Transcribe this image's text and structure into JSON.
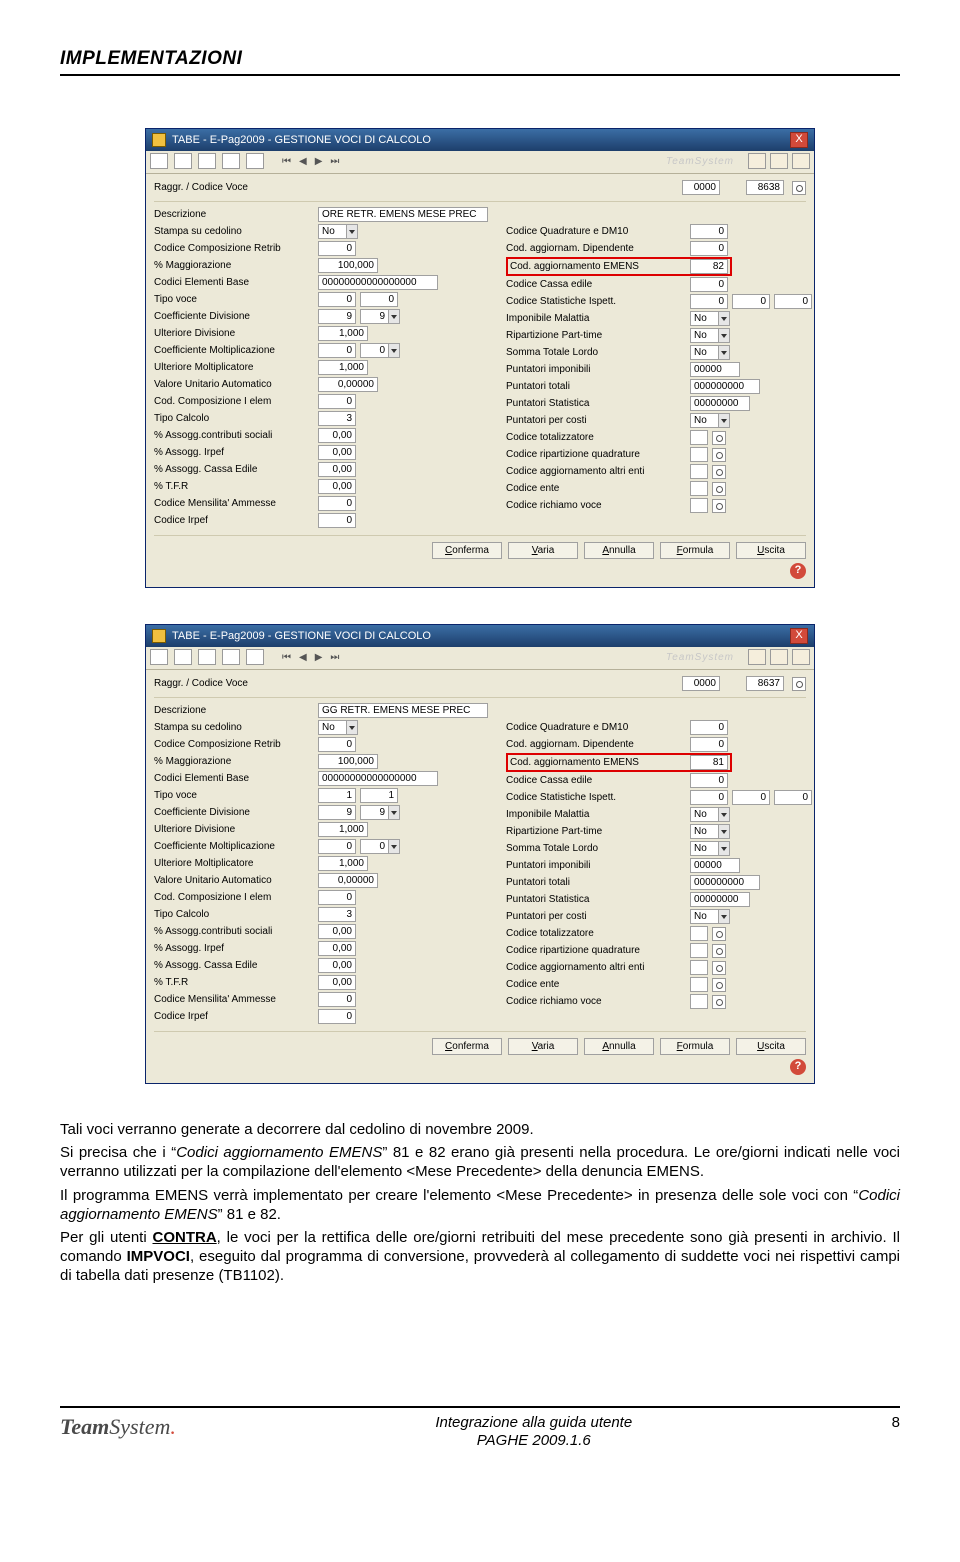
{
  "page_header": "IMPLEMENTAZIONI",
  "window_title": "TABE  -  E-Pag2009  -  GESTIONE VOCI DI CALCOLO",
  "brand": "TeamSystem",
  "close_x": "X",
  "nav": {
    "first": "⏮",
    "prev": "◀",
    "next": "▶",
    "last": "⏭"
  },
  "top": {
    "label": "Raggr. / Codice Voce",
    "v1": "0000",
    "v2_a": "8638",
    "v2_b": "8637"
  },
  "labels_left": [
    "Descrizione",
    "Stampa su cedolino",
    "Codice Composizione Retrib",
    "% Maggiorazione",
    "Codici Elementi Base",
    "Tipo voce",
    "Coefficiente Divisione",
    "Ulteriore Divisione",
    "Coefficiente Moltiplicazione",
    "Ulteriore Moltiplicatore",
    "Valore Unitario Automatico",
    "Cod. Composizione I elem",
    "Tipo Calcolo",
    "% Assogg.contributi sociali",
    "% Assogg. Irpef",
    "% Assogg. Cassa Edile",
    "% T.F.R",
    "Codice Mensilita' Ammesse",
    "Codice Irpef"
  ],
  "labels_right": [
    "Codice Quadrature e DM10",
    "Cod. aggiornam. Dipendente",
    "Cod. aggiornamento EMENS",
    "Codice Cassa edile",
    "Codice Statistiche Ispett.",
    "Imponibile Malattia",
    "Ripartizione Part-time",
    "Somma Totale Lordo",
    "Puntatori imponibili",
    "Puntatori totali",
    "Puntatori Statistica",
    "Puntatori per costi",
    "Codice totalizzatore",
    "Codice ripartizione quadrature",
    "Codice aggiornamento altri enti",
    "Codice ente",
    "Codice richiamo voce"
  ],
  "vals_a": {
    "descr": "ORE RETR. EMENS MESE PREC",
    "left": [
      "No",
      "0",
      "100,000",
      "00000000000000000",
      "0",
      "9",
      "1,000",
      "0",
      "1,000",
      "0,00000",
      "0",
      "3",
      "0,00",
      "0,00",
      "0,00",
      "0,00",
      "0",
      "0"
    ],
    "left_extra_tipo": "0",
    "left_extra_coeffdiv": "9",
    "left_extra_coeffmol": "0",
    "right": [
      "0",
      "0",
      "82",
      "0",
      "0",
      "No",
      "No",
      "No",
      "00000",
      "000000000",
      "00000000",
      "No"
    ],
    "stat2": "0",
    "stat3": "0"
  },
  "vals_b": {
    "descr": "GG RETR. EMENS MESE PREC",
    "left": [
      "No",
      "0",
      "100,000",
      "00000000000000000",
      "1",
      "9",
      "1,000",
      "0",
      "1,000",
      "0,00000",
      "0",
      "3",
      "0,00",
      "0,00",
      "0,00",
      "0,00",
      "0",
      "0"
    ],
    "left_extra_tipo": "1",
    "left_extra_coeffdiv": "9",
    "left_extra_coeffmol": "0",
    "right": [
      "0",
      "0",
      "81",
      "0",
      "0",
      "No",
      "No",
      "No",
      "00000",
      "000000000",
      "00000000",
      "No"
    ],
    "stat2": "0",
    "stat3": "0"
  },
  "buttons": {
    "conferma": "onferma",
    "varia": "aria",
    "annulla": "nnulla",
    "formula": "ormula",
    "uscita": "scita",
    "conferma_u": "C",
    "varia_u": "V",
    "annulla_u": "A",
    "formula_u": "F",
    "uscita_u": "U"
  },
  "body": {
    "p1": "Tali voci verranno generate a decorrere dal cedolino di novembre 2009.",
    "p2_a": "Si precisa che i “",
    "p2_codici": "Codici aggiornamento EMENS",
    "p2_b": "” 81 e 82 erano già presenti nella procedura. Le ore/giorni indicati nelle voci verranno utilizzati per la compilazione dell'elemento <Mese Precedente> della denuncia EMENS.",
    "p3_a": "Il programma EMENS verrà implementato per creare l'elemento <Mese Precedente> in presenza delle sole voci con “",
    "p3_codici": "Codici aggiornamento EMENS",
    "p3_b": "” 81 e 82.",
    "p4_a": "Per gli utenti ",
    "p4_contra": "CONTRA",
    "p4_b": ", le voci per la rettifica delle ore/giorni retribuiti del mese precedente sono già presenti in archivio. Il comando ",
    "p4_impvoci": "IMPVOCI",
    "p4_c": ", eseguito dal programma di conversione, provvederà al collegamento di suddette voci nei rispettivi campi di tabella dati presenze (TB1102)."
  },
  "footer": {
    "logo_a": "Team",
    "logo_b": "System",
    "center1": "Integrazione alla guida utente",
    "center2": "PAGHE 2009.1.6",
    "page": "8"
  },
  "help": "?"
}
